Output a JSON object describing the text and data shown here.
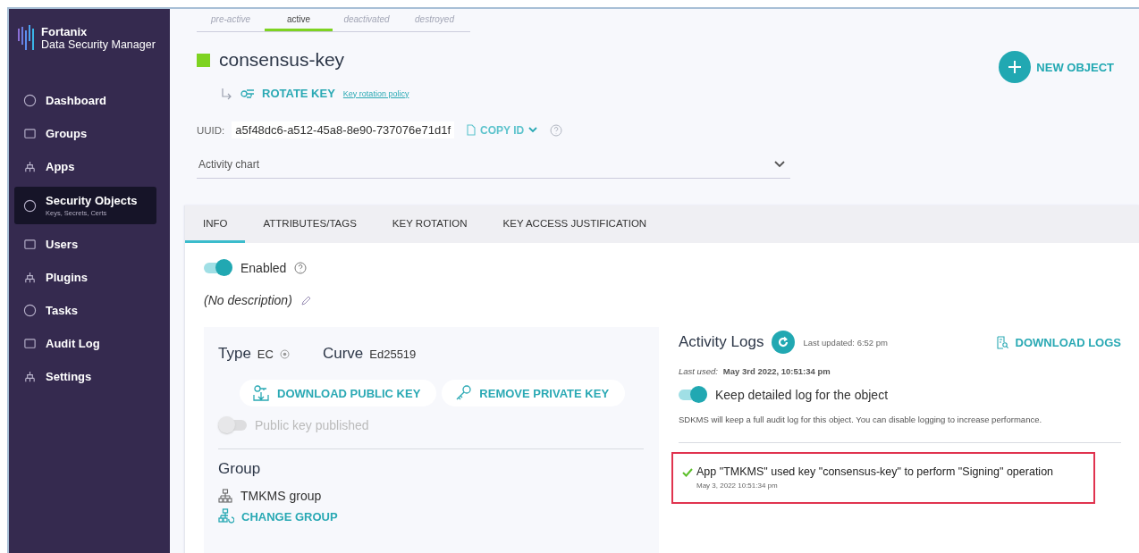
{
  "sidebar": {
    "brand": {
      "name": "Fortanix",
      "subtitle": "Data Security Manager"
    },
    "items": [
      {
        "label": "Dashboard",
        "selected": false
      },
      {
        "label": "Groups",
        "selected": false
      },
      {
        "label": "Apps",
        "selected": false
      },
      {
        "label": "Security Objects",
        "sub": "Keys, Secrets, Certs",
        "selected": true
      },
      {
        "label": "Users",
        "selected": false
      },
      {
        "label": "Plugins",
        "selected": false
      },
      {
        "label": "Tasks",
        "selected": false
      },
      {
        "label": "Audit Log",
        "selected": false
      },
      {
        "label": "Settings",
        "selected": false
      }
    ]
  },
  "lifecycle": [
    {
      "label": "pre-active",
      "selected": false
    },
    {
      "label": "active",
      "selected": true
    },
    {
      "label": "deactivated",
      "selected": false
    },
    {
      "label": "destroyed",
      "selected": false
    }
  ],
  "object_name": "consensus-key",
  "rotate_key": "ROTATE KEY",
  "rotation_policy_link": "Key rotation policy",
  "uuid": {
    "label": "UUID:",
    "value": "a5f48dc6-a512-45a8-8e90-737076e71d1f",
    "copy": "COPY ID"
  },
  "new_object": "NEW OBJECT",
  "activity_chart": {
    "label": "Activity chart",
    "expanded": false
  },
  "tabs": [
    {
      "label": "INFO",
      "selected": true
    },
    {
      "label": "ATTRIBUTES/TAGS",
      "selected": false
    },
    {
      "label": "KEY ROTATION",
      "selected": false
    },
    {
      "label": "KEY ACCESS JUSTIFICATION",
      "selected": false
    }
  ],
  "enabled": {
    "label": "Enabled",
    "on": true
  },
  "description": "(No description)",
  "key_info": {
    "type_label": "Type",
    "type_value": "EC",
    "curve_label": "Curve",
    "curve_value": "Ed25519"
  },
  "actions": [
    {
      "label": "DOWNLOAD PUBLIC KEY",
      "kind": "download"
    },
    {
      "label": "REMOVE PRIVATE KEY",
      "kind": "remove"
    }
  ],
  "public_key_published": {
    "label": "Public key published",
    "on": false,
    "disabled": true
  },
  "group": {
    "title": "Group",
    "name": "TMKMS group",
    "change": "CHANGE GROUP"
  },
  "activity_logs": {
    "title": "Activity Logs",
    "last_updated": "Last updated: 6:52 pm",
    "download": "DOWNLOAD LOGS",
    "last_used_label": "Last used:",
    "last_used_value": "May 3rd 2022, 10:51:34 pm",
    "detailed_log": {
      "label": "Keep detailed log for the object",
      "on": true
    },
    "note": "SDKMS will keep a full audit log for this object. You can disable logging to increase performance.",
    "entries": [
      {
        "message": "App \"TMKMS\" used key \"consensus-key\" to perform \"Signing\" operation",
        "time": "May 3, 2022 10:51:34 pm",
        "success": true,
        "highlighted": true
      }
    ]
  }
}
